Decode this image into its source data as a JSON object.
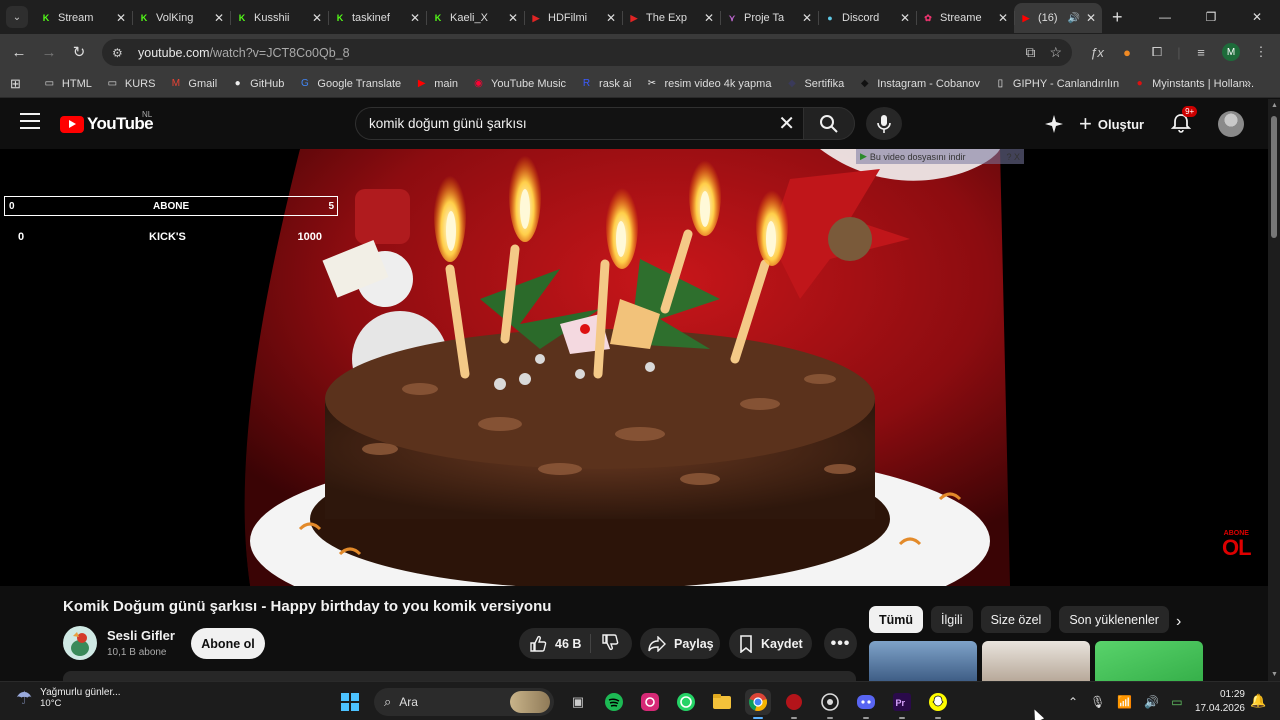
{
  "tabs": [
    {
      "title": "Stream",
      "icon": "kick-icon",
      "color": "#53fc18"
    },
    {
      "title": "VolKing",
      "icon": "kick-icon",
      "color": "#53fc18"
    },
    {
      "title": "Kusshii",
      "icon": "kick-icon",
      "color": "#53fc18"
    },
    {
      "title": "taskinef",
      "icon": "kick-icon",
      "color": "#53fc18"
    },
    {
      "title": "Kaeli_X",
      "icon": "kick-icon",
      "color": "#53fc18"
    },
    {
      "title": "HDFilmi",
      "icon": "play-icon",
      "color": "#e02424"
    },
    {
      "title": "The Exp",
      "icon": "play-icon",
      "color": "#e02424"
    },
    {
      "title": "Proje Ta",
      "icon": "proje-icon",
      "color": "#c56ad8"
    },
    {
      "title": "Discord",
      "icon": "discord-icon",
      "color": "#5fc9e6"
    },
    {
      "title": "Streame",
      "icon": "streame-icon",
      "color": "#e8336d"
    },
    {
      "title": "(16)",
      "icon": "youtube-icon",
      "color": "#ff0000",
      "active": true
    }
  ],
  "address": {
    "host": "youtube.com",
    "path": "/watch?v=JCT8Co0Qb_8"
  },
  "bookmarks": [
    {
      "label": "HTML",
      "icon": "folder-icon"
    },
    {
      "label": "KURS",
      "icon": "folder-icon"
    },
    {
      "label": "Gmail",
      "icon": "gmail-icon"
    },
    {
      "label": "GitHub",
      "icon": "github-icon"
    },
    {
      "label": "Google Translate",
      "icon": "translate-icon"
    },
    {
      "label": "main",
      "icon": "youtube-icon"
    },
    {
      "label": "YouTube Music",
      "icon": "yt-music-icon"
    },
    {
      "label": "rask ai",
      "icon": "rask-icon"
    },
    {
      "label": "resim video 4k yapma",
      "icon": "capcut-icon"
    },
    {
      "label": "Sertifika",
      "icon": "sertifika-icon"
    },
    {
      "label": "Instagram - Cobanov",
      "icon": "instagram-icon"
    },
    {
      "label": "GIPHY - Canlandırılın",
      "icon": "giphy-icon"
    },
    {
      "label": "Myinstants | Hollan...",
      "icon": "myinstants-icon"
    }
  ],
  "youtube": {
    "country": "NL",
    "logo_text": "YouTube",
    "search_query": "komik doğum günü şarkısı",
    "create_label": "Oluştur",
    "notification_badge": "9+"
  },
  "video": {
    "overlay": {
      "row1": {
        "left": "0",
        "label": "ABONE",
        "right": "5"
      },
      "row2": {
        "left": "0",
        "label": "KICK'S",
        "right": "1000"
      }
    },
    "download_bar": "Bu video dosyasını indir",
    "download_bar_controls": "? X",
    "corner_badge_small": "ABONE",
    "corner_badge_big": "OL"
  },
  "watch": {
    "title": "Komik Doğum günü şarkısı - Happy birthday to you komik versiyonu",
    "channel_name": "Sesli Gifler",
    "subscribers": "10,1 B abone",
    "subscribe_label": "Abone ol",
    "likes": "46 B",
    "share_label": "Paylaş",
    "save_label": "Kaydet"
  },
  "chips": [
    "Tümü",
    "İlgili",
    "Size özel",
    "Son yüklenenler"
  ],
  "taskbar": {
    "weather_text": "Yağmurlu günler...",
    "temperature": "10°C",
    "search_placeholder": "Ara",
    "time": "01:29",
    "date": "17.04.2026"
  }
}
